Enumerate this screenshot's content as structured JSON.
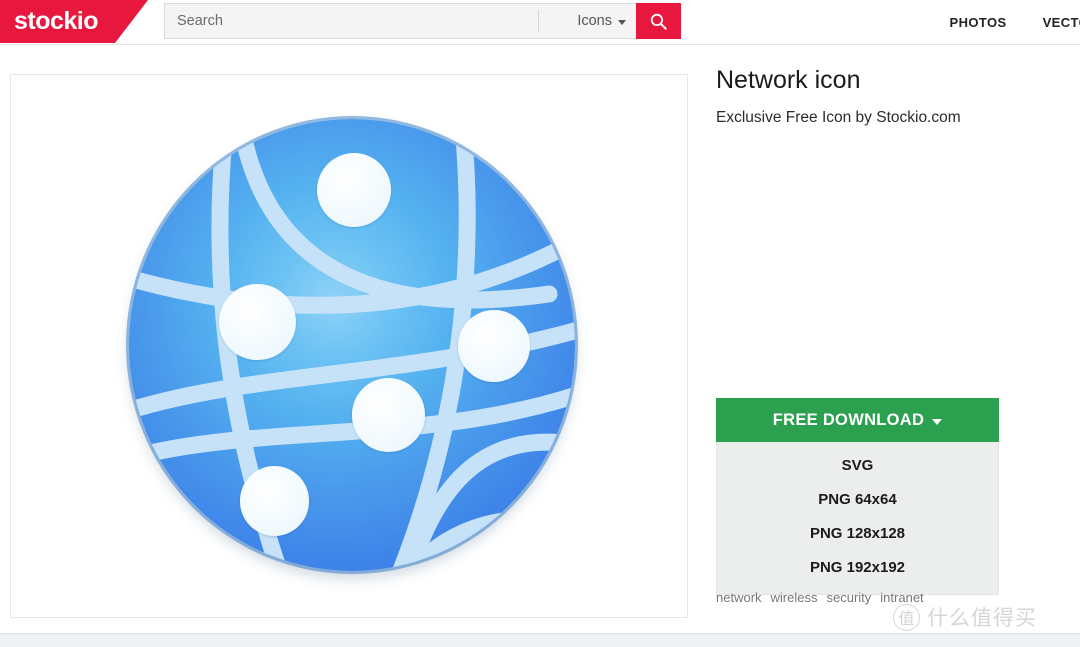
{
  "header": {
    "logo": "stockio",
    "search": {
      "placeholder": "Search",
      "value": "",
      "category": "Icons",
      "search_icon": "magnifier-icon",
      "accent_color": "#e8173d"
    },
    "nav": [
      {
        "label": "PHOTOS"
      },
      {
        "label": "VECTORS"
      }
    ]
  },
  "preview": {
    "icon_name": "network-globe-icon",
    "colors": {
      "sphere_light": "#8fd2f7",
      "sphere_mid": "#54b1ef",
      "sphere_dark": "#3a74e5",
      "lines": "#c5e2f8",
      "nodes": "#f5fbff",
      "rim": "#3c82c8"
    },
    "node_count": 5
  },
  "detail": {
    "title": "Network icon",
    "subtitle": "Exclusive Free Icon by Stockio.com"
  },
  "download": {
    "button_label": "FREE DOWNLOAD",
    "button_color": "#2ba04e",
    "caret_icon": "caret-down-icon",
    "options": [
      {
        "label": "SVG"
      },
      {
        "label": "PNG 64x64"
      },
      {
        "label": "PNG 128x128"
      },
      {
        "label": "PNG 192x192"
      }
    ]
  },
  "tags": [
    {
      "label": "network"
    },
    {
      "label": "wireless"
    },
    {
      "label": "security"
    },
    {
      "label": "intranet"
    }
  ],
  "watermark": {
    "mark": "值",
    "text": "什么值得买"
  }
}
